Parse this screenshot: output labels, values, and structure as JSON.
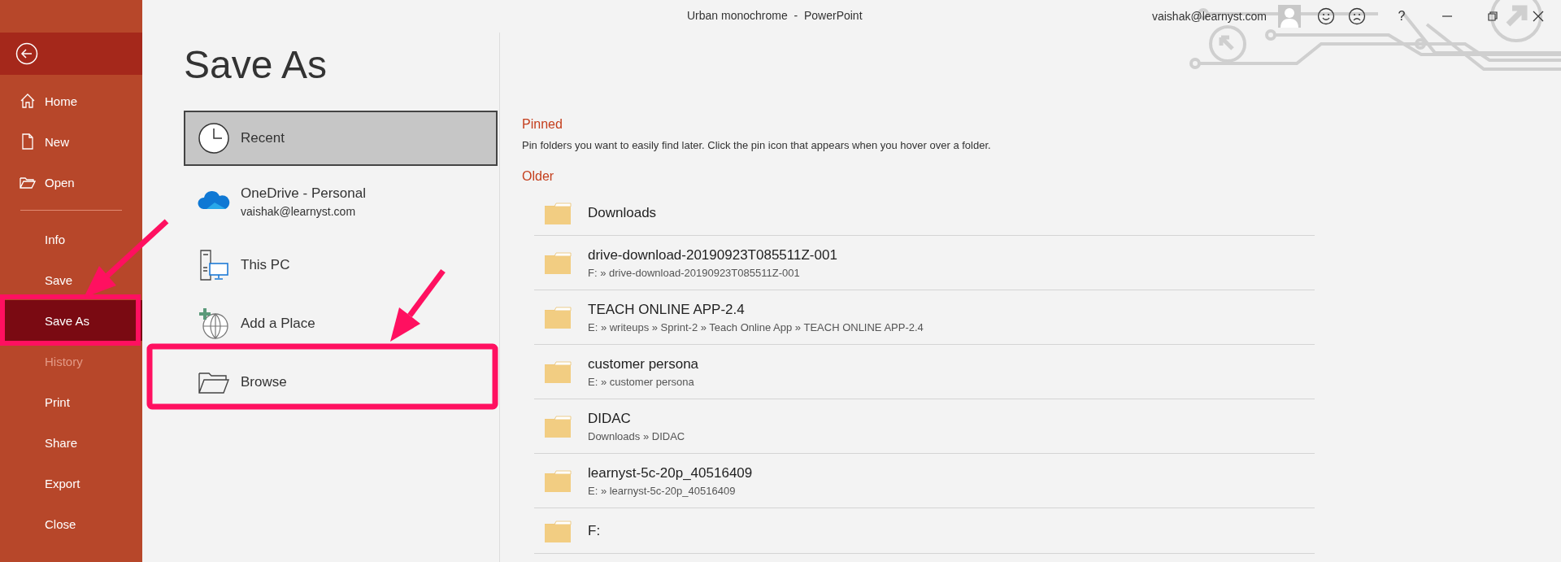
{
  "window": {
    "title": "Urban monochrome  -  PowerPoint",
    "account": "vaishak@learnyst.com",
    "help": "?"
  },
  "sidebar": {
    "nav": [
      {
        "label": "Home",
        "selected": false,
        "disabled": false
      },
      {
        "label": "New",
        "selected": false,
        "disabled": false
      },
      {
        "label": "Open",
        "selected": false,
        "disabled": false
      }
    ],
    "commands": [
      {
        "label": "Info",
        "selected": false,
        "disabled": false
      },
      {
        "label": "Save",
        "selected": false,
        "disabled": false
      },
      {
        "label": "Save As",
        "selected": true,
        "disabled": false
      },
      {
        "label": "History",
        "selected": false,
        "disabled": true
      },
      {
        "label": "Print",
        "selected": false,
        "disabled": false
      },
      {
        "label": "Share",
        "selected": false,
        "disabled": false
      },
      {
        "label": "Export",
        "selected": false,
        "disabled": false
      },
      {
        "label": "Close",
        "selected": false,
        "disabled": false
      }
    ]
  },
  "page_title": "Save As",
  "locations": [
    {
      "label": "Recent",
      "selected": true
    },
    {
      "label": "OneDrive - Personal",
      "sublabel": "vaishak@learnyst.com",
      "selected": false
    },
    {
      "label": "This PC",
      "selected": false
    },
    {
      "label": "Add a Place",
      "selected": false
    },
    {
      "label": "Browse",
      "selected": false
    }
  ],
  "pinned": {
    "heading": "Pinned",
    "hint": "Pin folders you want to easily find later. Click the pin icon that appears when you hover over a folder."
  },
  "older": {
    "heading": "Older",
    "folders": [
      {
        "name": "Downloads"
      },
      {
        "name": "drive-download-20190923T085511Z-001",
        "path": "F: » drive-download-20190923T085511Z-001"
      },
      {
        "name": "TEACH ONLINE APP-2.4",
        "path": "E: » writeups » Sprint-2 » Teach Online App » TEACH ONLINE APP-2.4"
      },
      {
        "name": "customer persona",
        "path": "E: » customer persona"
      },
      {
        "name": "DIDAC",
        "path": "Downloads » DIDAC"
      },
      {
        "name": "learnyst-5c-20p_40516409",
        "path": "E: » learnyst-5c-20p_40516409"
      },
      {
        "name": "F:"
      }
    ]
  }
}
